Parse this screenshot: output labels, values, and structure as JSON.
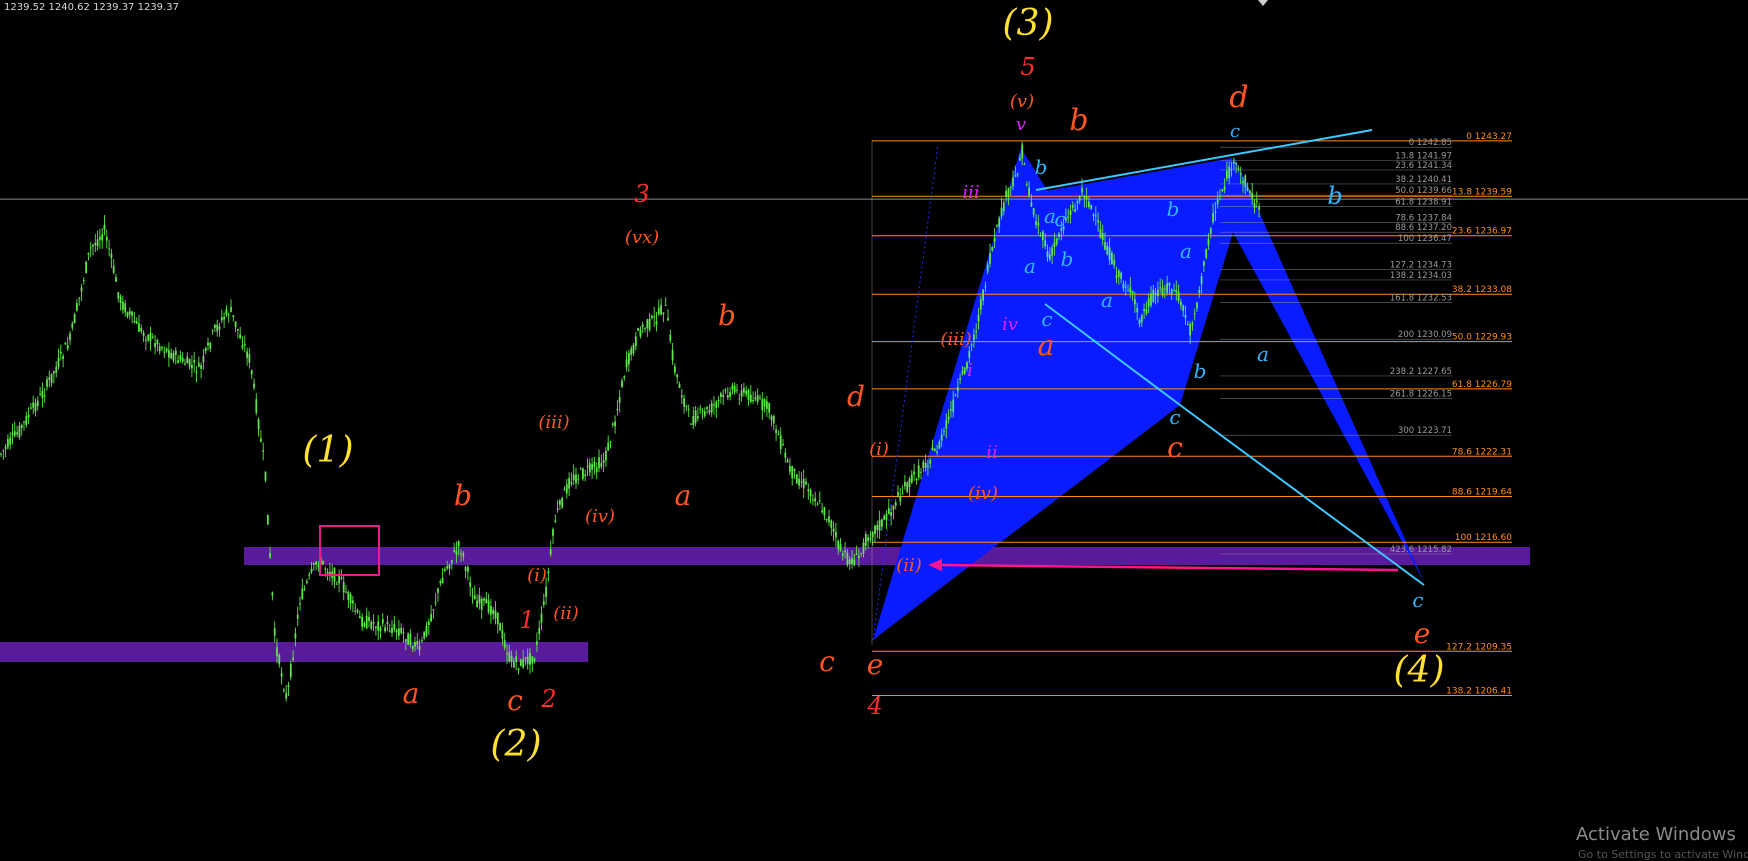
{
  "header": {
    "ohlc": "1239.52 1240.62 1239.37 1239.37"
  },
  "watermark": {
    "title": "Activate Windows",
    "subtitle": "Go to Settings to activate Windows."
  },
  "colors": {
    "background": "#000000",
    "candle": "#5ee64a",
    "zone": "#5a1a9c",
    "wedge": "#0a1cff",
    "fib_orange": "#ff8c1a",
    "fib_gray": "#9a9a9a",
    "trend_cyan": "#3fc8ff",
    "arrow_magenta": "#ff1493",
    "label_yellow": "#ffe033",
    "label_orange": "#ff5522",
    "label_red": "#ff2d2d",
    "label_magenta": "#dd22ff",
    "label_cyan": "#33b4ff"
  },
  "chart_data": {
    "type": "candlestick",
    "price_range": [
      1204.5,
      1257.5
    ],
    "horizontal_line": 1239.4,
    "fib_levels_orange": [
      {
        "pct": "0",
        "price": "1243.27"
      },
      {
        "pct": "13.8",
        "price": "1239.59"
      },
      {
        "pct": "23.6",
        "price": "1236.97"
      },
      {
        "pct": "38.2",
        "price": "1233.08"
      },
      {
        "pct": "50.0",
        "price": "1229.93"
      },
      {
        "pct": "61.8",
        "price": "1226.79"
      },
      {
        "pct": "78.6",
        "price": "1222.31"
      },
      {
        "pct": "88.6",
        "price": "1219.64"
      },
      {
        "pct": "100",
        "price": "1216.60"
      },
      {
        "pct": "127.2",
        "price": "1209.35"
      },
      {
        "pct": "138.2",
        "price": "1206.41"
      }
    ],
    "fib_levels_gray": [
      {
        "pct": "0",
        "price": "1242.85"
      },
      {
        "pct": "13.8",
        "price": "1241.97"
      },
      {
        "pct": "23.6",
        "price": "1241.34"
      },
      {
        "pct": "38.2",
        "price": "1240.41"
      },
      {
        "pct": "50.0",
        "price": "1239.66"
      },
      {
        "pct": "61.8",
        "price": "1238.91"
      },
      {
        "pct": "78.6",
        "price": "1237.84"
      },
      {
        "pct": "88.6",
        "price": "1237.20"
      },
      {
        "pct": "100",
        "price": "1236.47"
      },
      {
        "pct": "127.2",
        "price": "1234.73"
      },
      {
        "pct": "138.2",
        "price": "1234.03"
      },
      {
        "pct": "161.8",
        "price": "1232.53"
      },
      {
        "pct": "200",
        "price": "1230.09"
      },
      {
        "pct": "238.2",
        "price": "1227.65"
      },
      {
        "pct": "261.8",
        "price": "1226.15"
      },
      {
        "pct": "300",
        "price": "1223.71"
      },
      {
        "pct": "423.6",
        "price": "1215.82"
      }
    ],
    "wave_labels": [
      {
        "text": "(1)",
        "color": "yellow"
      },
      {
        "text": "(2)",
        "color": "yellow"
      },
      {
        "text": "(3)",
        "color": "yellow"
      },
      {
        "text": "(4)",
        "color": "yellow"
      },
      {
        "text": "a",
        "color": "orange"
      },
      {
        "text": "b",
        "color": "orange"
      },
      {
        "text": "c",
        "color": "orange"
      },
      {
        "text": "1",
        "color": "red"
      },
      {
        "text": "2",
        "color": "red"
      },
      {
        "text": "(i)",
        "color": "orange"
      },
      {
        "text": "(ii)",
        "color": "orange"
      },
      {
        "text": "(iii)",
        "color": "orange"
      },
      {
        "text": "(iv)",
        "color": "orange"
      },
      {
        "text": "3",
        "color": "red"
      },
      {
        "text": "(vx)",
        "color": "orange"
      },
      {
        "text": "b",
        "color": "orange"
      },
      {
        "text": "a",
        "color": "orange"
      },
      {
        "text": "d",
        "color": "orange"
      },
      {
        "text": "c",
        "color": "orange"
      },
      {
        "text": "e",
        "color": "orange"
      },
      {
        "text": "4",
        "color": "red"
      },
      {
        "text": "(i)",
        "color": "orange"
      },
      {
        "text": "(ii)",
        "color": "orange"
      },
      {
        "text": "(iii)",
        "color": "orange"
      },
      {
        "text": "(iv)",
        "color": "orange"
      },
      {
        "text": "i",
        "color": "magenta"
      },
      {
        "text": "ii",
        "color": "magenta"
      },
      {
        "text": "iii",
        "color": "magenta"
      },
      {
        "text": "iv",
        "color": "magenta"
      },
      {
        "text": "v",
        "color": "magenta"
      },
      {
        "text": "(v)",
        "color": "orange"
      },
      {
        "text": "5",
        "color": "red"
      },
      {
        "text": "b",
        "color": "orange"
      },
      {
        "text": "a",
        "color": "orange"
      },
      {
        "text": "c",
        "color": "orange"
      },
      {
        "text": "d",
        "color": "orange"
      },
      {
        "text": "e",
        "color": "orange"
      },
      {
        "text": "b",
        "color": "cyan"
      },
      {
        "text": "a",
        "color": "cyan"
      },
      {
        "text": "c",
        "color": "cyan"
      },
      {
        "text": "b",
        "color": "cyan"
      },
      {
        "text": "a",
        "color": "cyan"
      },
      {
        "text": "a",
        "color": "cyan"
      },
      {
        "text": "c",
        "color": "cyan"
      },
      {
        "text": "b",
        "color": "cyan"
      },
      {
        "text": "a",
        "color": "cyan"
      },
      {
        "text": "b",
        "color": "cyan"
      },
      {
        "text": "c",
        "color": "cyan"
      },
      {
        "text": "c",
        "color": "cyan"
      },
      {
        "text": "b",
        "color": "cyan"
      },
      {
        "text": "a",
        "color": "cyan"
      },
      {
        "text": "c",
        "color": "cyan"
      }
    ]
  }
}
